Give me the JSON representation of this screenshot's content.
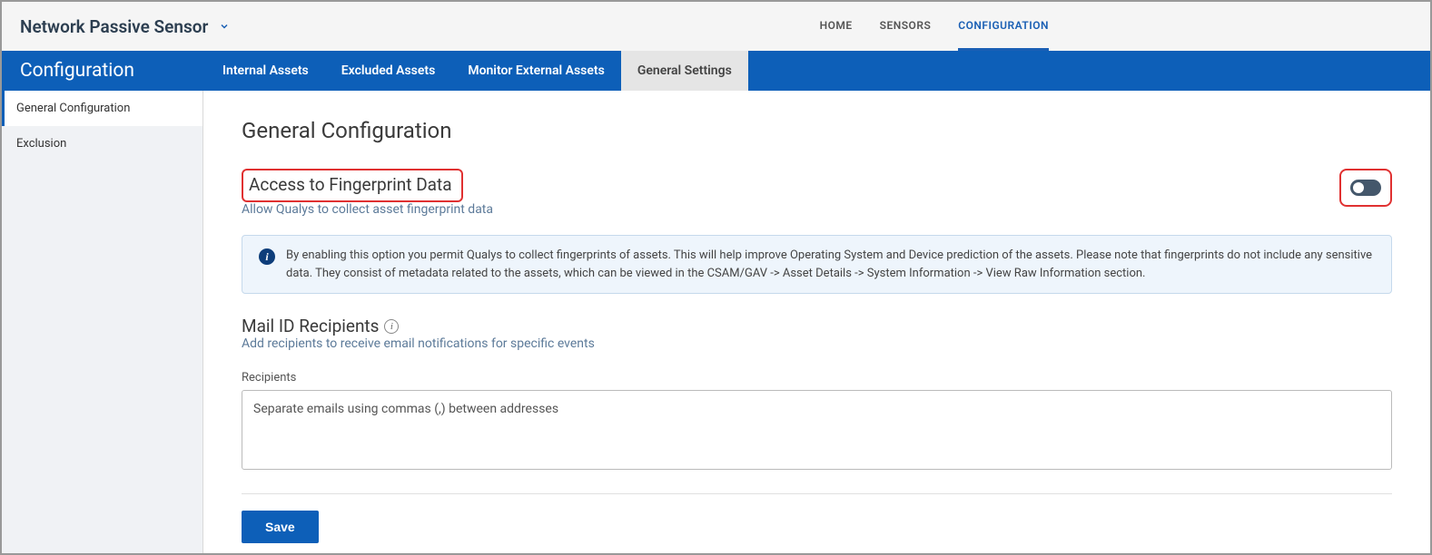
{
  "app_title": "Network Passive Sensor",
  "top_nav": {
    "items": [
      "HOME",
      "SENSORS",
      "CONFIGURATION"
    ],
    "active_index": 2
  },
  "page_heading": "Configuration",
  "sub_nav": {
    "items": [
      "Internal Assets",
      "Excluded Assets",
      "Monitor External Assets",
      "General Settings"
    ],
    "active_index": 3
  },
  "sidebar": {
    "items": [
      "General Configuration",
      "Exclusion"
    ],
    "active_index": 0
  },
  "content": {
    "title": "General Configuration",
    "fingerprint": {
      "heading": "Access to Fingerprint Data",
      "sub": "Allow Qualys to collect asset fingerprint data",
      "info": "By enabling this option you permit Qualys to collect fingerprints of assets. This will help improve Operating System and Device prediction of the assets. Please note that fingerprints do not include any sensitive data. They consist of metadata related to the assets, which can be viewed in the CSAM/GAV -> Asset Details -> System Information -> View Raw Information section."
    },
    "mail": {
      "heading": "Mail ID Recipients",
      "sub": "Add recipients to receive email notifications for specific events",
      "field_label": "Recipients",
      "placeholder": "Separate emails using commas (,) between addresses"
    },
    "save_label": "Save"
  }
}
